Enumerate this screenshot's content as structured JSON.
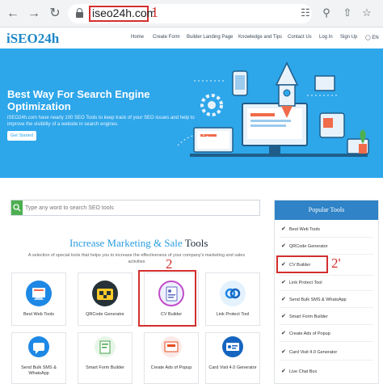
{
  "browser": {
    "url": "iseo24h.com",
    "back_icon": "arrow-left-icon",
    "forward_icon": "arrow-right-icon",
    "reload_icon": "reload-icon"
  },
  "annotations": {
    "label_1": "1",
    "label_2": "2",
    "label_2p": "2'"
  },
  "site": {
    "logo": "iSEO24h",
    "menu": [
      "Home",
      "Create Form",
      "Builder Landing Page",
      "Knowledge and Tips",
      "Contact Us",
      "Log In",
      "Sign Up",
      "EN"
    ]
  },
  "hero": {
    "title": "Best Way For Search Engine Optimization",
    "subtitle": "iSEO24h.com have nearly 100 SEO Tools to keep track of your SEO issues and help to improve the visibility of a website in search engines.",
    "button": "Get Started"
  },
  "search": {
    "placeholder": "Type any word to search SEO tools"
  },
  "section": {
    "title_part1": "Increase Marketing & Sale",
    "title_part2": " Tools",
    "desc": "A selection of special tools that helps you to increase the effectiveness of your company's marketing and sales activities"
  },
  "tools": [
    {
      "label": "Best Web Tools",
      "color": "#1e88e5"
    },
    {
      "label": "QRCode Generator",
      "color": "#263238"
    },
    {
      "label": "CV Builder",
      "color": "#eef0ff"
    },
    {
      "label": "Link Protect Tool",
      "color": "#e3f2fd"
    }
  ],
  "tools_row2": [
    {
      "label": "Send Bulk SMS & WhatsApp",
      "color": "#1e88e5"
    },
    {
      "label": "Smart Form Builder",
      "color": "#e8f5e9"
    },
    {
      "label": "Create Ads of Popup",
      "color": "#fbe9e7"
    },
    {
      "label": "Card Visit 4.0 Generator",
      "color": "#1565c0"
    }
  ],
  "popular": {
    "title": "Popular Tools",
    "items": [
      "Best Web Tools",
      "QRCode Generator",
      "CV Builder",
      "Link Protect Tool",
      "Send Bulk SMS & WhatsApp",
      "Smart Form Builder",
      "Create Ads of Popup",
      "Card Visit 4.0 Generator",
      "Live Chat Box"
    ]
  }
}
